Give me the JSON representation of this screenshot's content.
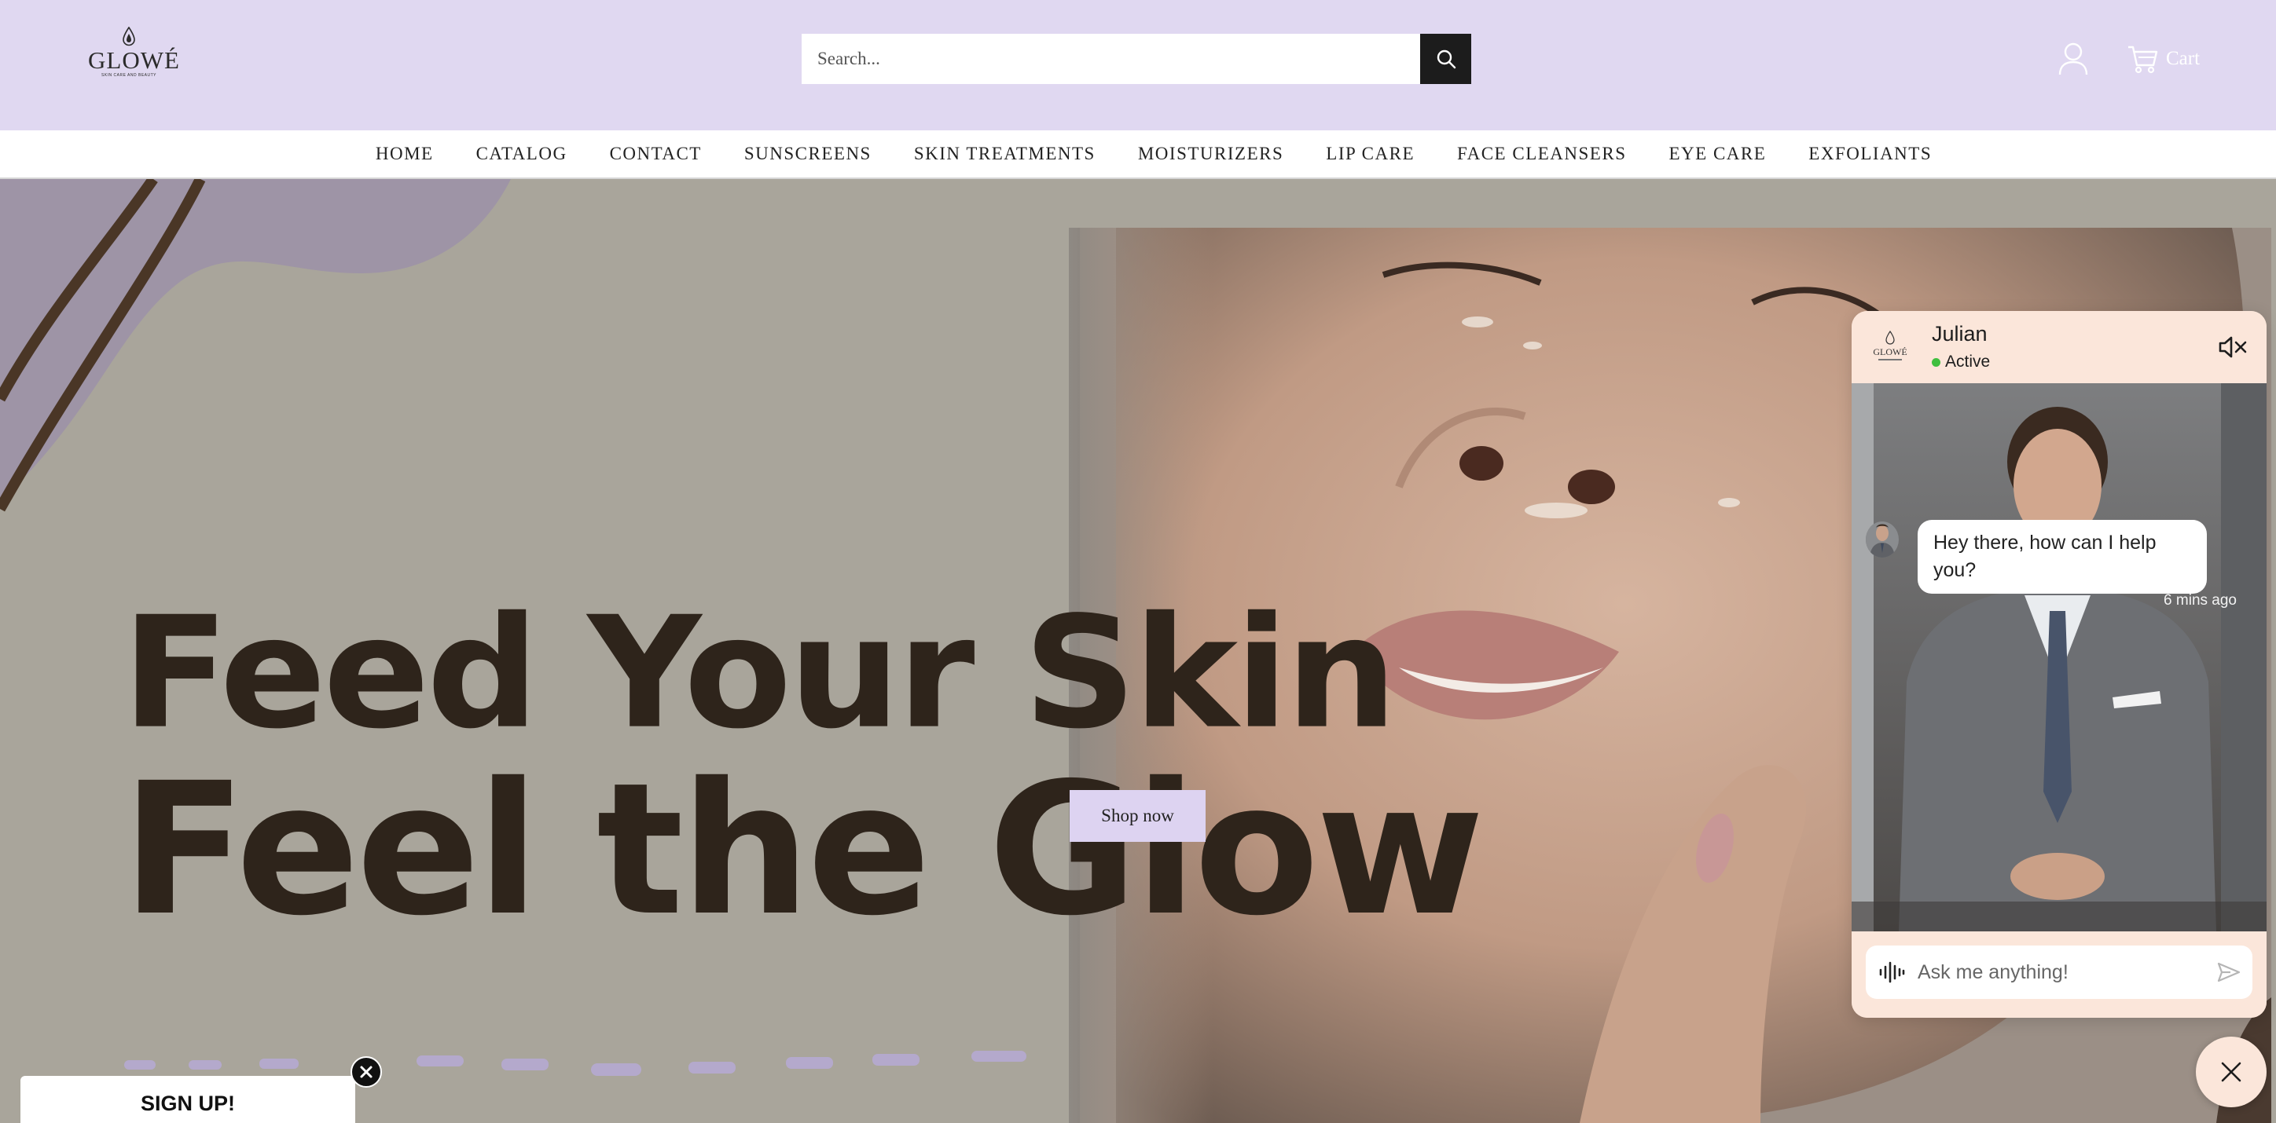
{
  "brand": {
    "name": "GLOWÉ",
    "tagline": "SKIN CARE AND BEAUTY"
  },
  "header": {
    "search_placeholder": "Search...",
    "cart_label": "Cart"
  },
  "nav": {
    "items": [
      {
        "label": "HOME"
      },
      {
        "label": "CATALOG"
      },
      {
        "label": "CONTACT"
      },
      {
        "label": "SUNSCREENS"
      },
      {
        "label": "SKIN TREATMENTS"
      },
      {
        "label": "MOISTURIZERS"
      },
      {
        "label": "LIP CARE"
      },
      {
        "label": "FACE CLEANSERS"
      },
      {
        "label": "EYE CARE"
      },
      {
        "label": "EXFOLIANTS"
      }
    ]
  },
  "hero": {
    "headline_line1": "Feed Your Skin",
    "headline_line2": "Feel the Glow",
    "cta_label": "Shop now"
  },
  "chat": {
    "agent_name": "Julian",
    "status": "Active",
    "message": "Hey there, how can I help you?",
    "message_time": "6 mins ago",
    "input_placeholder": "Ask me anything!"
  },
  "signup": {
    "label": "SIGN UP!"
  },
  "colors": {
    "header_bg": "#e0d8f1",
    "hero_bg": "#a9a59b",
    "headline_color": "#2e241b",
    "cta_bg": "#ddd3f1",
    "chat_bg": "#fbe6da",
    "status_green": "#3fbf3f"
  },
  "icons": [
    "drop-logo-icon",
    "search-icon",
    "account-icon",
    "cart-icon",
    "mute-speaker-icon",
    "voice-wave-icon",
    "send-icon",
    "close-icon"
  ]
}
